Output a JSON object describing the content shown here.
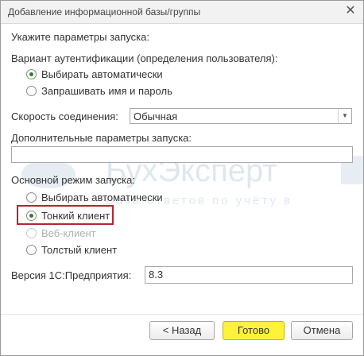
{
  "dialog": {
    "title": "Добавление информационной базы/группы",
    "close_glyph": "✕"
  },
  "launch": {
    "heading": "Укажите параметры запуска:",
    "auth_label": "Вариант аутентификации (определения пользователя):",
    "auth_options": [
      {
        "label": "Выбирать автоматически",
        "selected": true
      },
      {
        "label": "Запрашивать имя и пароль",
        "selected": false
      }
    ],
    "speed_label": "Скорость соединения:",
    "speed_value": "Обычная",
    "extra_params_label": "Дополнительные параметры запуска:",
    "extra_params_value": "",
    "mode_label": "Основной режим запуска:",
    "mode_options": [
      {
        "label": "Выбирать автоматически",
        "selected": false,
        "enabled": true
      },
      {
        "label": "Тонкий клиент",
        "selected": true,
        "enabled": true
      },
      {
        "label": "Веб-клиент",
        "selected": false,
        "enabled": false
      },
      {
        "label": "Толстый клиент",
        "selected": false,
        "enabled": true
      }
    ],
    "version_label": "Версия 1С:Предприятия:",
    "version_value": "8.3"
  },
  "watermark": {
    "brand": "БухЭксперт",
    "tagline": "База ответов по учёту в"
  },
  "footer": {
    "back_label": "< Назад",
    "done_label": "Готово",
    "cancel_label": "Отмена"
  },
  "colors": {
    "highlight_border": "#b8232f",
    "primary_button": "#fff23a",
    "radio_dot": "#2f7d32"
  }
}
